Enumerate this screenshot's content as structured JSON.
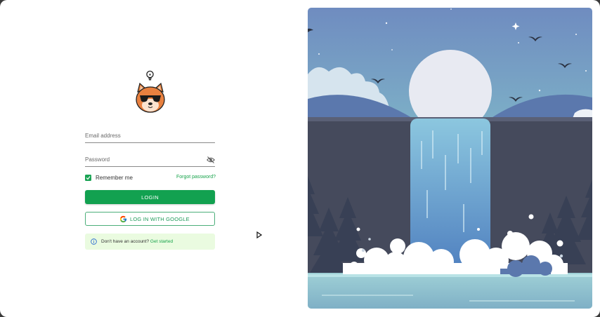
{
  "login": {
    "email_label": "Email address",
    "password_label": "Password",
    "remember_label": "Remember me",
    "forgot_label": "Forgot password?",
    "login_button": "LOGIN",
    "google_button": "LOG IN WITH GOOGLE",
    "signup_prompt": "Don't have an account?",
    "signup_link": "Get started",
    "remember_checked": true
  },
  "icons": {
    "logo": "shiba-sunglasses-icon",
    "bulb": "lightbulb-icon",
    "eye": "eye-off-icon",
    "google": "google-icon",
    "info": "info-icon",
    "cursor": "cursor-icon"
  },
  "colors": {
    "accent": "#12a150",
    "info_bg": "#eafbe0"
  }
}
